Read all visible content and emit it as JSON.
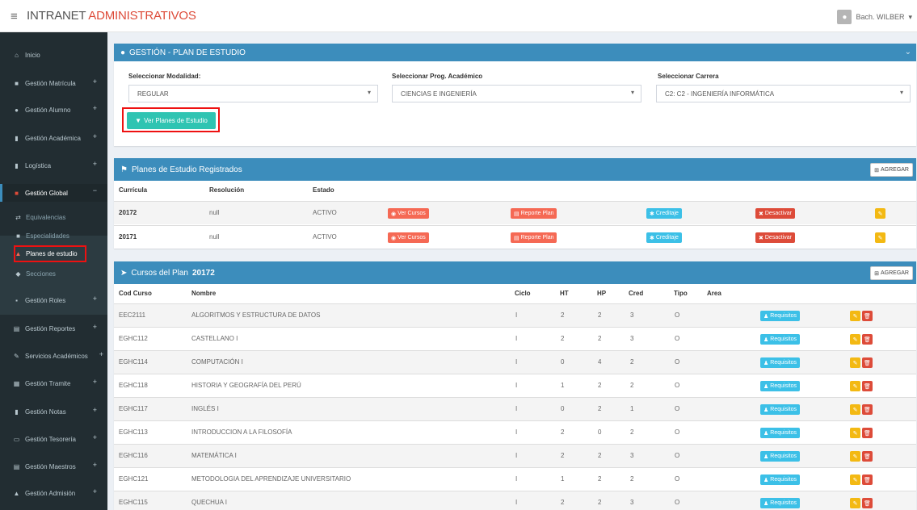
{
  "header": {
    "brand_part1": "INTRANET",
    "brand_part2": "ADMINISTRATIVOS",
    "user": "Bach. WILBER",
    "user_caret": "▾"
  },
  "sidebar": {
    "items": [
      {
        "label": "Inicio",
        "plus": ""
      },
      {
        "label": "Gestión Matrícula",
        "plus": "+"
      },
      {
        "label": "Gestión Alumno",
        "plus": "+"
      },
      {
        "label": "Gestión Académica",
        "plus": "+"
      },
      {
        "label": "Logística",
        "plus": "+"
      },
      {
        "label": "Gestión Global",
        "plus": "−"
      },
      {
        "label": "Gestión Roles",
        "plus": "+"
      },
      {
        "label": "Gestión Reportes",
        "plus": "+"
      },
      {
        "label": "Servicios Académicos",
        "plus": "+"
      },
      {
        "label": "Gestión Tramite",
        "plus": "+"
      },
      {
        "label": "Gestión Notas",
        "plus": "+"
      },
      {
        "label": "Gestión Tesorería",
        "plus": "+"
      },
      {
        "label": "Gestión Maestros",
        "plus": "+"
      },
      {
        "label": "Gestión Admisión",
        "plus": "+"
      }
    ],
    "submenu": [
      {
        "label": "Equivalencias"
      },
      {
        "label": "Especialidades"
      },
      {
        "label": "Planes de estudio"
      },
      {
        "label": "Secciones"
      }
    ]
  },
  "filter_panel": {
    "title": "GESTIÓN - PLAN DE ESTUDIO",
    "modalidad_label": "Seleccionar Modalidad:",
    "modalidad_value": "REGULAR",
    "programa_label": "Seleccionar Prog. Académico",
    "programa_value": "CIENCIAS E INGENIERÍA",
    "carrera_label": "Seleccionar Carrera",
    "carrera_value": "C2: C2 - INGENIERÍA INFORMÁTICA",
    "ver_planes_button": "Ver Planes de Estudio"
  },
  "planes_panel": {
    "title": "Planes de Estudio Registrados",
    "agregar": "AGREGAR",
    "headers": {
      "curricula": "Currícula",
      "resolucion": "Resolución",
      "estado": "Estado"
    },
    "buttons": {
      "ver_cursos": "Ver Cursos",
      "reporte": "Reporte Plan",
      "creditaje": "Creditaje",
      "desactivar": "Desactivar"
    },
    "rows": [
      {
        "curricula": "20172",
        "resolucion": "null",
        "estado": "ACTIVO"
      },
      {
        "curricula": "20171",
        "resolucion": "null",
        "estado": "ACTIVO"
      }
    ]
  },
  "cursos_panel": {
    "title_prefix": "Cursos del Plan",
    "plan": "20172",
    "agregar": "AGREGAR",
    "headers": {
      "cod": "Cod Curso",
      "nombre": "Nombre",
      "ciclo": "Ciclo",
      "ht": "HT",
      "hp": "HP",
      "cred": "Cred",
      "tipo": "Tipo",
      "area": "Area"
    },
    "requisitos": "Requisitos",
    "rows": [
      {
        "cod": "EEC2111",
        "nombre": "ALGORITMOS Y ESTRUCTURA DE DATOS",
        "ciclo": "I",
        "ht": "2",
        "hp": "2",
        "cred": "3",
        "tipo": "O"
      },
      {
        "cod": "EGHC112",
        "nombre": "CASTELLANO I",
        "ciclo": "I",
        "ht": "2",
        "hp": "2",
        "cred": "3",
        "tipo": "O"
      },
      {
        "cod": "EGHC114",
        "nombre": "COMPUTACIÓN I",
        "ciclo": "I",
        "ht": "0",
        "hp": "4",
        "cred": "2",
        "tipo": "O"
      },
      {
        "cod": "EGHC118",
        "nombre": "HISTORIA Y GEOGRAFÍA DEL PERÚ",
        "ciclo": "I",
        "ht": "1",
        "hp": "2",
        "cred": "2",
        "tipo": "O"
      },
      {
        "cod": "EGHC117",
        "nombre": "INGLÉS I",
        "ciclo": "I",
        "ht": "0",
        "hp": "2",
        "cred": "1",
        "tipo": "O"
      },
      {
        "cod": "EGHC113",
        "nombre": "INTRODUCCION A LA FILOSOFÍA",
        "ciclo": "I",
        "ht": "2",
        "hp": "0",
        "cred": "2",
        "tipo": "O"
      },
      {
        "cod": "EGHC116",
        "nombre": "MATEMÁTICA I",
        "ciclo": "I",
        "ht": "2",
        "hp": "2",
        "cred": "3",
        "tipo": "O"
      },
      {
        "cod": "EGHC121",
        "nombre": "METODOLOGIA DEL APRENDIZAJE UNIVERSITARIO",
        "ciclo": "I",
        "ht": "1",
        "hp": "2",
        "cred": "2",
        "tipo": "O"
      },
      {
        "cod": "EGHC115",
        "nombre": "QUECHUA I",
        "ciclo": "I",
        "ht": "2",
        "hp": "2",
        "cred": "3",
        "tipo": "O"
      }
    ]
  },
  "icons": [
    "menu-icon",
    "user-icon",
    "home-icon",
    "folder-icon",
    "user-solid-icon",
    "bookmark-icon",
    "arrows-icon",
    "org-icon",
    "lock-icon",
    "list-icon",
    "edit-icon",
    "table-icon",
    "card-icon",
    "flag-icon",
    "rocket-icon",
    "eye-icon",
    "file-icon",
    "gear-icon",
    "times-icon",
    "filter-icon",
    "plus-square-icon",
    "sitemap-icon",
    "tag-icon",
    "trash-icon"
  ],
  "colors": {
    "brand_red": "#dd4b39",
    "header_blue": "#3c8dbc",
    "sidebar_bg": "#222d32",
    "teal": "#2fc4b2",
    "highlight_red": "#ee1111"
  }
}
